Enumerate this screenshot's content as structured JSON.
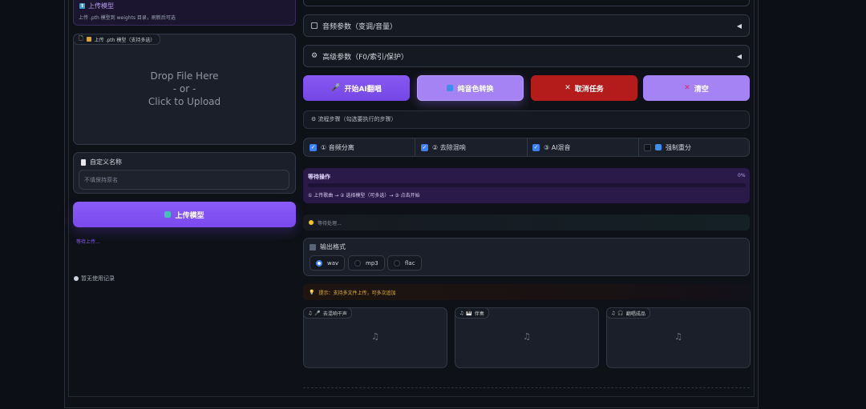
{
  "left": {
    "upload_section_title": "上传模型",
    "upload_section_hint": "上传 .pth 模型到 weights 目录，刷新后可选",
    "dropzone_tab": "上传 .pth 模型（支持多选）",
    "dropzone_line1": "Drop File Here",
    "dropzone_line2": "- or -",
    "dropzone_line3": "Click to Upload",
    "custom_name_label": "自定义名称",
    "custom_name_placeholder": "不填保持原名",
    "upload_button": "上传模型",
    "upload_status": "等待上传...",
    "history_text": "暂无使用记录"
  },
  "right": {
    "audio_params": "音频参数（变调/音量）",
    "advanced_params": "高级参数（F0/索引/保护）",
    "buttons": {
      "start": "开始AI翻唱",
      "convert": "纯音色转换",
      "cancel": "取消任务",
      "clear": "清空"
    },
    "steps_title": "流程步骤（勾选要执行的步骤）",
    "checks": [
      {
        "label": "① 音频分离",
        "checked": true
      },
      {
        "label": "② 去除混响",
        "checked": true
      },
      {
        "label": "③ AI混音",
        "checked": true
      },
      {
        "label": "强制重分",
        "checked": false
      }
    ],
    "progress": {
      "title": "等待操作",
      "percent": "0%",
      "value": 0,
      "steps": "① 上传歌曲 → ② 选择模型（可多选）→ ③ 点击开始"
    },
    "status_text": "等待处理...",
    "output_format": {
      "label": "输出格式",
      "options": [
        "wav",
        "mp3",
        "flac"
      ],
      "selected": "wav"
    },
    "tip": "提示：支持多文件上传，可多次追加",
    "audio_outputs": [
      "去混响干声",
      "伴奏",
      "翻唱成品"
    ]
  }
}
